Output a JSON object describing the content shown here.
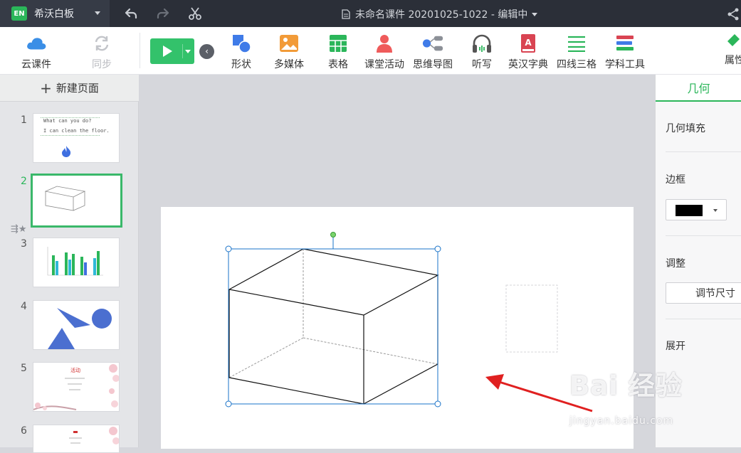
{
  "titlebar": {
    "app_name": "希沃白板",
    "logo_text": "EN",
    "document_title": "未命名课件 20201025-1022 - 编辑中"
  },
  "toolbar": {
    "cloud_label": "云课件",
    "sync_label": "同步",
    "tools": [
      {
        "label": "形状",
        "icon": "shape-icon"
      },
      {
        "label": "多媒体",
        "icon": "media-icon"
      },
      {
        "label": "表格",
        "icon": "table-icon"
      },
      {
        "label": "课堂活动",
        "icon": "class-activity-icon"
      },
      {
        "label": "思维导图",
        "icon": "mind-map-icon"
      },
      {
        "label": "听写",
        "icon": "headphones-icon"
      },
      {
        "label": "英汉字典",
        "icon": "dictionary-icon"
      },
      {
        "label": "四线三格",
        "icon": "four-lines-icon"
      },
      {
        "label": "学科工具",
        "icon": "subject-tools-icon"
      }
    ],
    "properties_label": "属性"
  },
  "left_panel": {
    "new_page_label": "新建页面",
    "slides": [
      {
        "number": "1",
        "text_line1": "What can you do?",
        "text_line2": "I can clean the floor."
      },
      {
        "number": "2"
      },
      {
        "number": "3"
      },
      {
        "number": "4"
      },
      {
        "number": "5",
        "title": "活动"
      },
      {
        "number": "6"
      }
    ]
  },
  "right_panel": {
    "tab": "几何",
    "geometry_fill": "几何填充",
    "border": "边框",
    "border_color": "#000000",
    "adjust": "调整",
    "resize_button": "调节尺寸",
    "expand": "展开"
  },
  "watermark": {
    "brand": "Bai 经验",
    "url": "jingyan.baidu.com"
  },
  "colors": {
    "accent": "#2bb65a",
    "selection": "#1a73c8",
    "arrow": "#e02020"
  }
}
